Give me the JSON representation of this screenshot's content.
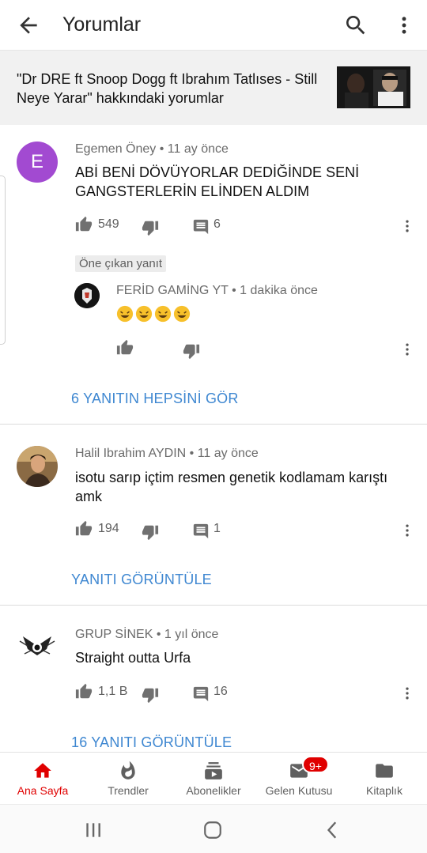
{
  "header": {
    "title": "Yorumlar",
    "back_icon": "arrow-back-icon",
    "search_icon": "search-icon",
    "more_icon": "more-vert-icon"
  },
  "video": {
    "title": "\"Dr DRE ft Snoop Dogg ft Ibrahım Tatlıses - Still Neye Yarar\" hakkındaki yorumlar"
  },
  "comments": [
    {
      "avatar_letter": "E",
      "avatar_color": "#a24ad1",
      "author": "Egemen Öney",
      "time": "11 ay önce",
      "text": "ABİ BENİ DÖVÜYORLAR DEDİĞİNDE SENİ GANGSTERLERİN ELİNDEN ALDIM",
      "likes": "549",
      "replies": "6",
      "highlight_label": "Öne çıkan yanıt",
      "reply": {
        "author": "FERİD GAMİNG YT",
        "time": "1 dakika önce",
        "emojis": [
          "rolling-laugh-emoji",
          "rolling-laugh-emoji",
          "rolling-laugh-emoji",
          "rolling-laugh-emoji"
        ]
      },
      "view_replies": "6 YANITIN HEPSİNİ GÖR"
    },
    {
      "author": "Halil Ibrahim AYDIN",
      "time": "11 ay önce",
      "text": "isotu sarıp içtim resmen genetik kodlamam karıştı amk",
      "likes": "194",
      "replies": "1",
      "view_replies": "YANITI GÖRÜNTÜLE"
    },
    {
      "author": "GRUP SİNEK",
      "time": "1 yıl önce",
      "text": "Straight outta Urfa",
      "likes": "1,1 B",
      "replies": "16",
      "view_replies": "16 YANITI GÖRÜNTÜLE"
    }
  ],
  "meta_separator": "•",
  "bottom_nav": [
    {
      "label": "Ana Sayfa",
      "icon": "home-icon",
      "active": true
    },
    {
      "label": "Trendler",
      "icon": "trending-flame-icon",
      "active": false
    },
    {
      "label": "Abonelikler",
      "icon": "subscriptions-icon",
      "active": false
    },
    {
      "label": "Gelen Kutusu",
      "icon": "inbox-mail-icon",
      "active": false,
      "badge": "9+"
    },
    {
      "label": "Kitaplık",
      "icon": "library-folder-icon",
      "active": false
    }
  ],
  "colors": {
    "accent_red": "#e00000",
    "link_blue": "#3e87d1",
    "banner_bg": "#f1f1f1"
  }
}
